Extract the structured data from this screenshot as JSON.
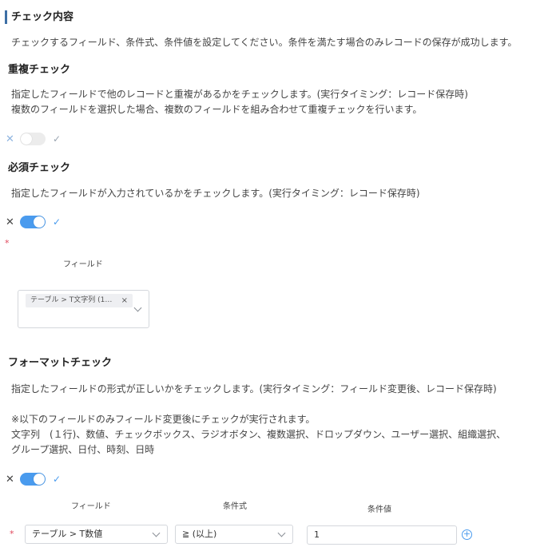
{
  "section": {
    "title": "チェック内容",
    "description": "チェックするフィールド、条件式、条件値を設定してください。条件を満たす場合のみレコードの保存が成功します。"
  },
  "duplicate_check": {
    "heading": "重複チェック",
    "lines": [
      "指定したフィールドで他のレコードと重複があるかをチェックします。(実行タイミング：レコード保存時)",
      "複数のフィールドを選択した場合、複数のフィールドを組み合わせて重複チェックを行います。"
    ],
    "enabled": false,
    "x_icon": "close-icon",
    "check_icon": "check-icon"
  },
  "required_check": {
    "heading": "必須チェック",
    "description": "指定したフィールドが入力されているかをチェックします。(実行タイミング：レコード保存時)",
    "enabled": true,
    "required_mark": "*",
    "field_label": "フィールド",
    "selected_tag": "テーブル > T文字列 (1…",
    "tag_close": "×"
  },
  "format_check": {
    "heading": "フォーマットチェック",
    "description": "指定したフィールドの形式が正しいかをチェックします。(実行タイミング：フィールド変更後、レコード保存時)",
    "note_lines": [
      "※以下のフィールドのみフィールド変更後にチェックが実行されます。",
      "文字列　(１行)、数値、チェックボックス、ラジオボタン、複数選択、ドロップダウン、ユーザー選択、組織選択、",
      "グループ選択、日付、時刻、日時"
    ],
    "enabled": true,
    "columns": {
      "field": "フィールド",
      "operator": "条件式",
      "value": "条件値"
    },
    "row": {
      "required_mark": "*",
      "field": "テーブル > T数値",
      "operator": "≧ (以上)",
      "value": "1"
    },
    "add_icon": "plus-circle-icon"
  },
  "colors": {
    "accent": "#4a9bee",
    "title_bar": "#3d6fa5",
    "required": "#e0475b"
  }
}
